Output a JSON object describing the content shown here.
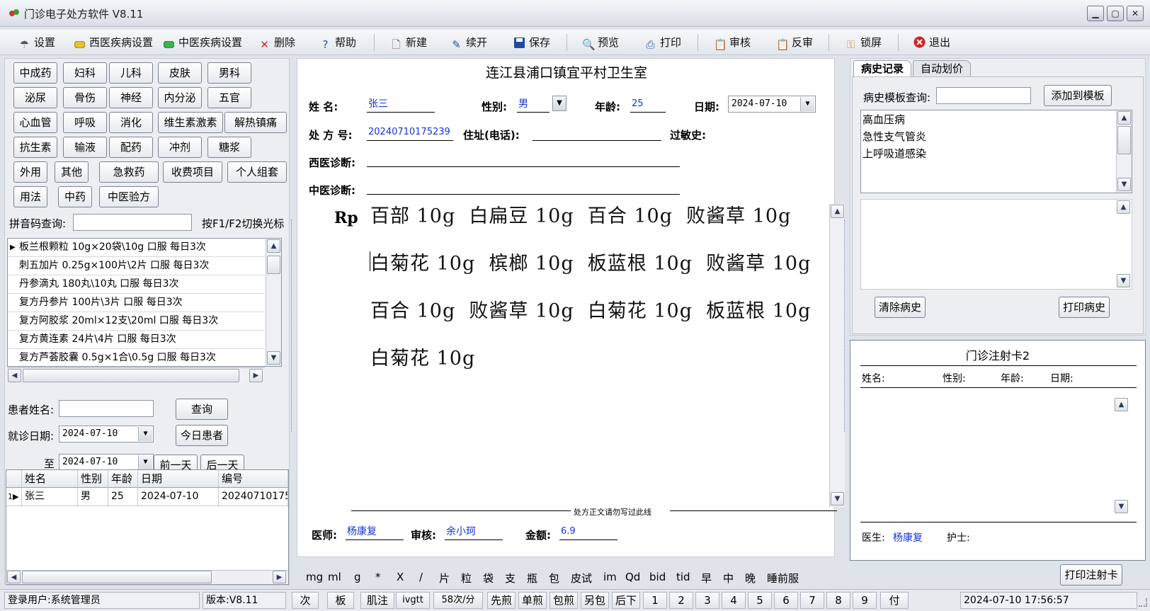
{
  "window": {
    "title": "门诊电子处方软件 V8.11"
  },
  "toolbar": [
    {
      "label": "设置",
      "icon": "settings-icon"
    },
    {
      "label": "西医疾病设置",
      "icon": "yellow-pill-icon"
    },
    {
      "label": "中医疾病设置",
      "icon": "green-pill-icon"
    },
    {
      "label": "删除",
      "icon": "delete-icon"
    },
    {
      "label": "帮助",
      "icon": "help-icon"
    },
    {
      "label": "新建",
      "icon": "new-document-icon"
    },
    {
      "label": "续开",
      "icon": "pen-icon"
    },
    {
      "label": "保存",
      "icon": "save-icon"
    },
    {
      "label": "预览",
      "icon": "preview-icon"
    },
    {
      "label": "打印",
      "icon": "printer-icon"
    },
    {
      "label": "审核",
      "icon": "audit-icon"
    },
    {
      "label": "反审",
      "icon": "unaudit-icon"
    },
    {
      "label": "锁屏",
      "icon": "key-icon"
    },
    {
      "label": "退出",
      "icon": "exit-icon"
    }
  ],
  "categories": [
    "中成药",
    "妇科",
    "儿科",
    "皮肤",
    "男科",
    "泌尿",
    "骨伤",
    "神经",
    "内分泌",
    "五官",
    "心血管",
    "呼吸",
    "消化",
    "维生素激素",
    "解热镇痛",
    "抗生素",
    "输液",
    "配药",
    "冲剂",
    "糖浆",
    "外用",
    "其他",
    "急救药",
    "收费项目",
    "个人组套",
    "用法",
    "中药",
    "中医验方"
  ],
  "pinyin_search": {
    "label": "拼音码查询:",
    "value": "",
    "hint": "按F1/F2切换光标"
  },
  "drug_list": [
    "板兰根颗粒   10g×20袋\\10g 口服 每日3次",
    "刺五加片   0.25g×100片\\2片 口服 每日3次",
    "丹参滴丸   180丸\\10丸 口服 每日3次",
    "复方丹参片   100片\\3片 口服 每日3次",
    "复方阿胶浆   20ml×12支\\20ml 口服  每日3次",
    "复方黄连素   24片\\4片 口服 每日3次",
    "复方芦荟胶囊   0.5g×1合\\0.5g 口服 每日3次"
  ],
  "patient_search": {
    "name_label": "患者姓名:",
    "name_value": "",
    "query_button": "查询",
    "date_label": "就诊日期:",
    "date_from": "2024-07-10",
    "today_button": "今日患者",
    "to_label": "至",
    "date_to": "2024-07-10",
    "prev_day_button": "前一天",
    "next_day_button": "后一天"
  },
  "patient_grid": {
    "headers": [
      "姓名",
      "性别",
      "年龄",
      "日期",
      "编号"
    ],
    "rows": [
      {
        "idx": "1",
        "cells": [
          "张三",
          "男",
          "25",
          "2024-07-10",
          "20240710175"
        ]
      }
    ]
  },
  "rx": {
    "clinic": "连江县浦口镇宜平村卫生室",
    "name_label": "姓    名:",
    "name": "张三",
    "sex_label": "性别:",
    "sex": "男",
    "age_label": "年龄:",
    "age": "25",
    "date_label": "日期:",
    "date": "2024-07-10",
    "no_label": "处 方 号:",
    "no": "20240710175239",
    "addr_label": "住址(电话):",
    "addr": "",
    "allergy_label": "过敏史:",
    "allergy": "",
    "wm_dx_label": "西医诊断:",
    "wm_dx": "",
    "tcm_dx_label": "中医诊断:",
    "tcm_dx": "",
    "rp_label": "Rp",
    "lines": [
      "百部 10g  白扁豆 10g  百合 10g  败酱草 10g",
      "白菊花 10g  槟榔 10g  板蓝根 10g  败酱草 10g",
      "百合 10g  败酱草 10g  白菊花 10g  板蓝根 10g",
      "白菊花 10g"
    ],
    "divider_note": "处方正文请勿写过此线",
    "doctor_label": "医师:",
    "doctor": "杨康复",
    "audit_label": "审核:",
    "auditor": "余小珂",
    "amount_label": "金额:",
    "amount": "6.9"
  },
  "units": [
    "mg",
    "ml",
    "g",
    "*",
    "X",
    "/",
    "片",
    "粒",
    "袋",
    "支",
    "瓶",
    "包",
    "皮试",
    "im",
    "Qd",
    "bid",
    "tid",
    "早",
    "中",
    "晚",
    "睡前服"
  ],
  "history": {
    "tabs": [
      "病史记录",
      "自动划价"
    ],
    "template_label": "病史模板查询:",
    "template_value": "",
    "add_button": "添加到模板",
    "templates": [
      "高血压病",
      "急性支气管炎",
      "上呼吸道感染"
    ],
    "clear_button": "清除病史",
    "print_button": "打印病史"
  },
  "injection_card": {
    "title": "门诊注射卡2",
    "name_label": "姓名:",
    "sex_label": "性别:",
    "age_label": "年龄:",
    "date_label": "日期:",
    "doctor_label": "医生:",
    "doctor": "杨康复",
    "nurse_label": "护士:",
    "nurse": "",
    "print_button": "打印注射卡"
  },
  "statusbar": {
    "user": "登录用户:系统管理员",
    "version": "版本:V8.11",
    "keys": [
      "次",
      "板",
      "肌注",
      "ivgtt",
      "58次/分",
      "先煎",
      "单煎",
      "包煎",
      "另包",
      "后下",
      "1",
      "2",
      "3",
      "4",
      "5",
      "6",
      "7",
      "8",
      "9",
      "付"
    ],
    "datetime": "2024-07-10 17:56:57"
  }
}
